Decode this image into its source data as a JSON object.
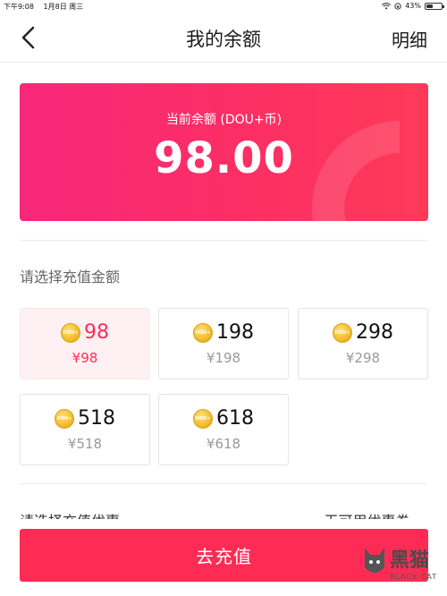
{
  "status_bar": {
    "time": "下午9:08",
    "date": "1月8日 周三",
    "battery_text": "43%",
    "battery_level": 0.43
  },
  "nav": {
    "title": "我的余额",
    "detail_label": "明细"
  },
  "balance": {
    "label": "当前余额 (DOU+币)",
    "value": "98.00"
  },
  "section_title": "请选择充值金额",
  "options": [
    {
      "amount": "98",
      "price": "¥98",
      "selected": true
    },
    {
      "amount": "198",
      "price": "¥198",
      "selected": false
    },
    {
      "amount": "298",
      "price": "¥298",
      "selected": false
    },
    {
      "amount": "518",
      "price": "¥518",
      "selected": false
    },
    {
      "amount": "618",
      "price": "¥618",
      "selected": false
    }
  ],
  "coin_label": "DOU+",
  "partial_row": {
    "left": "请选择充值优惠",
    "right": "无可用优惠券 ›"
  },
  "recharge_button": "去充值",
  "watermark": {
    "text": "黑猫",
    "sub": "BLACK CAT"
  },
  "colors": {
    "accent": "#fe2c55",
    "card_gradient_start": "#f7287b",
    "card_gradient_end": "#fe3a58"
  }
}
